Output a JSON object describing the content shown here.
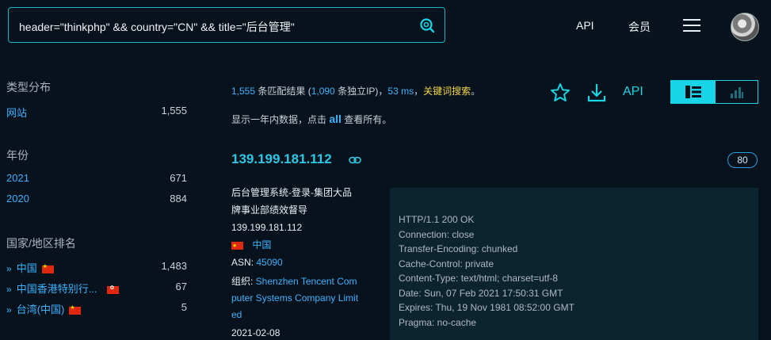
{
  "search": {
    "query": "header=\"thinkphp\" && country=\"CN\" && title=\"后台管理\""
  },
  "nav": {
    "api": "API",
    "member": "会员"
  },
  "left": {
    "type_title": "类型分布",
    "types": [
      {
        "label": "网站",
        "count": "1,555"
      }
    ],
    "year_title": "年份",
    "years": [
      {
        "label": "2021",
        "count": "671"
      },
      {
        "label": "2020",
        "count": "884"
      }
    ],
    "country_title": "国家/地区排名",
    "countries": [
      {
        "label": "中国",
        "count": "1,483"
      },
      {
        "label": "中国香港特别行...",
        "count": "67"
      },
      {
        "label": "台湾(中国)",
        "count": "5"
      }
    ]
  },
  "stats": {
    "matches": "1,555",
    "matches_text": " 条匹配结果 (",
    "unique_ips": "1,090",
    "unique_text": " 条独立IP)，",
    "ms": "53 ms",
    "sep": "，",
    "keyword": "关键词搜索",
    "end": "。"
  },
  "info": {
    "pre": "显示一年内数据，点击 ",
    "all": "all",
    "post": " 查看所有。"
  },
  "actions": {
    "api": "API"
  },
  "result": {
    "ip": "139.199.181.112",
    "port": "80",
    "title_line1": "后台管理系统-登录-集团大品",
    "title_line2": "牌事业部绩效督导",
    "ip_link": "139.199.181.112",
    "country": "中国",
    "asn_label": "ASN: ",
    "asn": "45090",
    "org_label": "组织: ",
    "org1": "Shenzhen Tencent Com",
    "org2": "puter Systems Company Limit",
    "org3": "ed",
    "date": "2021-02-08",
    "banner": [
      "HTTP/1.1 200 OK",
      "Connection: close",
      "Transfer-Encoding: chunked",
      "Cache-Control: private",
      "Content-Type: text/html; charset=utf-8",
      "Date: Sun, 07 Feb 2021 17:50:31 GMT",
      "Expires: Thu, 19 Nov 1981 08:52:00 GMT",
      "Pragma: no-cache"
    ]
  }
}
